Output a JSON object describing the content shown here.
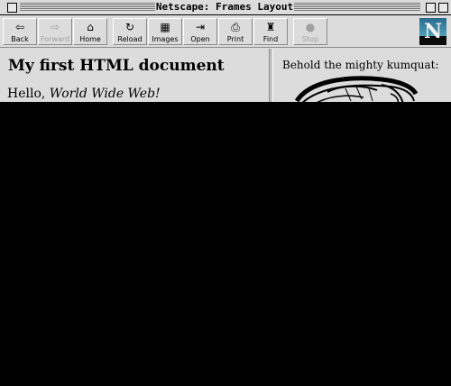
{
  "window": {
    "title": "Netscape: Frames Layout"
  },
  "toolbar": {
    "buttons": [
      {
        "label": "Back",
        "icon": "back-arrow-icon",
        "glyph": "⇦",
        "enabled": true
      },
      {
        "label": "Forward",
        "icon": "forward-arrow-icon",
        "glyph": "⇨",
        "enabled": false
      },
      {
        "label": "Home",
        "icon": "home-icon",
        "glyph": "⌂",
        "enabled": true
      },
      {
        "label": "Reload",
        "icon": "reload-icon",
        "glyph": "↻",
        "enabled": true
      },
      {
        "label": "Images",
        "icon": "images-icon",
        "glyph": "▦",
        "enabled": true
      },
      {
        "label": "Open",
        "icon": "open-icon",
        "glyph": "⇥",
        "enabled": true
      },
      {
        "label": "Print",
        "icon": "print-icon",
        "glyph": "⎙",
        "enabled": true
      },
      {
        "label": "Find",
        "icon": "find-icon",
        "glyph": "♜",
        "enabled": true
      },
      {
        "label": "Stop",
        "icon": "stop-icon",
        "glyph": "●",
        "enabled": false
      }
    ],
    "logo": {
      "icon": "netscape-logo-icon",
      "letter": "N"
    }
  },
  "left_frame": {
    "heading": "My first HTML document",
    "line_prefix": "Hello, ",
    "line_emphasis": "World Wide Web!"
  },
  "right_frame": {
    "caption": "Behold the mighty kumquat:",
    "image": "kumquat-drawing"
  },
  "colors": {
    "chrome": "#dcdcdc",
    "text": "#000000",
    "disabled": "#a0a0a0",
    "background": "#000000"
  }
}
